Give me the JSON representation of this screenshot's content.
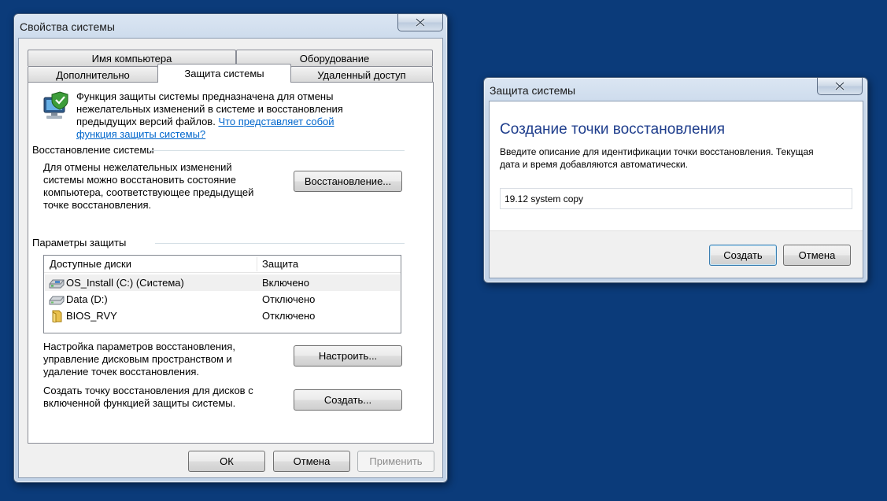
{
  "main_window": {
    "title": "Свойства системы",
    "tabs_row1": [
      "Имя компьютера",
      "Оборудование"
    ],
    "tabs_row2": [
      "Дополнительно",
      "Защита системы",
      "Удаленный доступ"
    ],
    "intro_text": [
      "Функция защиты системы предназначена для отмены",
      "нежелательных изменений в системе и восстановления",
      "предыдущих версий файлов."
    ],
    "intro_link_1": "Что представляет собой",
    "intro_link_2": "функция защиты системы?",
    "restore_group": {
      "title": "Восстановление системы",
      "text": [
        "Для отмены нежелательных изменений",
        "системы можно восстановить состояние",
        "компьютера, соответствующее предыдущей",
        "точке восстановления."
      ],
      "button": "Восстановление..."
    },
    "protection_group": {
      "title": "Параметры защиты",
      "columns": [
        "Доступные диски",
        "Защита"
      ],
      "rows": [
        {
          "name": "OS_Install (C:) (Система)",
          "status": "Включено",
          "icon": "system-drive-icon"
        },
        {
          "name": "Data (D:)",
          "status": "Отключено",
          "icon": "hard-drive-icon"
        },
        {
          "name": "BIOS_RVY",
          "status": "Отключено",
          "icon": "folder-drive-icon"
        }
      ],
      "configure_text": [
        "Настройка параметров восстановления,",
        "управление дисковым пространством и",
        "удаление точек восстановления."
      ],
      "configure_button": "Настроить...",
      "create_text": [
        "Создать точку восстановления для дисков с",
        "включенной функцией защиты системы."
      ],
      "create_button": "Создать..."
    },
    "footer": {
      "ok": "ОК",
      "cancel": "Отмена",
      "apply": "Применить"
    }
  },
  "dialog": {
    "title": "Защита системы",
    "heading": "Создание точки восстановления",
    "description": [
      "Введите описание для идентификации точки восстановления. Текущая",
      "дата и время добавляются автоматически."
    ],
    "input_value": "19.12 system copy",
    "create_button": "Создать",
    "cancel_button": "Отмена"
  },
  "colors": {
    "desktop": "#0b3b7a",
    "heading_blue": "#1e3d8c",
    "link": "#0066cc"
  }
}
